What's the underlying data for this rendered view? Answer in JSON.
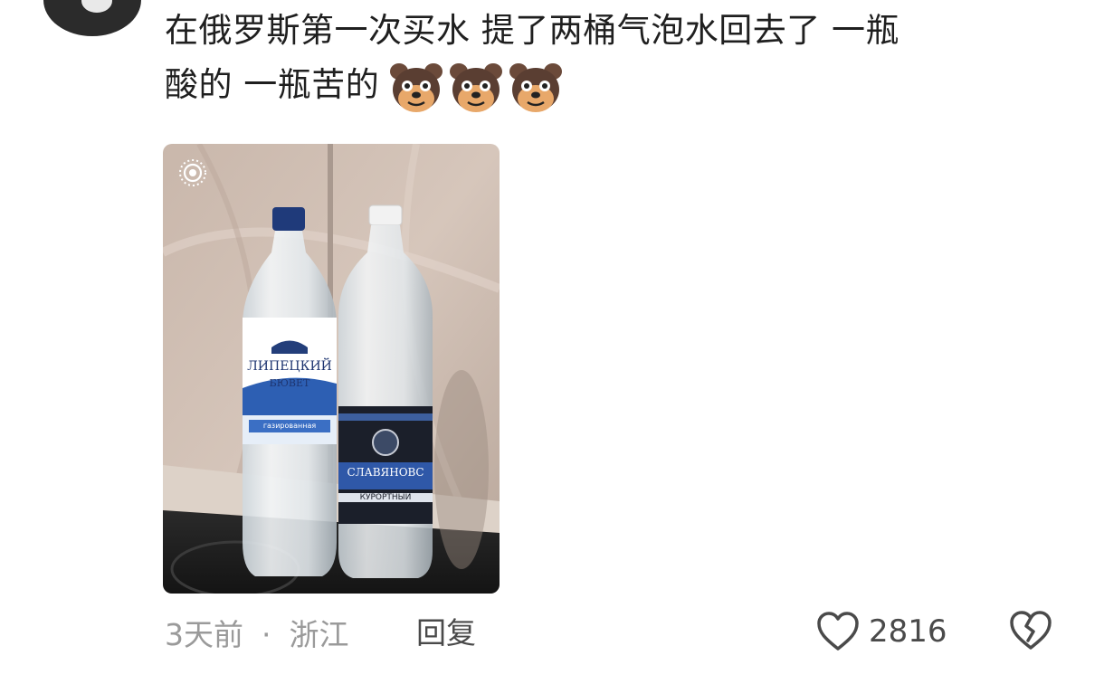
{
  "comment": {
    "line1": "在俄罗斯第一次买水  提了两桶气泡水回去了 一瓶",
    "line2": "酸的  一瓶苦的",
    "emoji": [
      "dog-emoji",
      "dog-emoji",
      "dog-emoji"
    ]
  },
  "photo": {
    "bottle_left_label_main": "ЛИПЕЦКИЙ",
    "bottle_left_label_sub": "БЮВЕТ",
    "bottle_left_label_band": "газированная",
    "bottle_right_label_main": "СЛАВЯНОВС",
    "bottle_right_label_sub": "КУРОРТНЫЙ",
    "live_icon": "live-photo-icon"
  },
  "meta": {
    "time": "3天前",
    "separator": "·",
    "location": "浙江",
    "reply_label": "回复"
  },
  "actions": {
    "like_icon": "heart-icon",
    "like_count": "2816",
    "dislike_icon": "broken-heart-icon"
  }
}
